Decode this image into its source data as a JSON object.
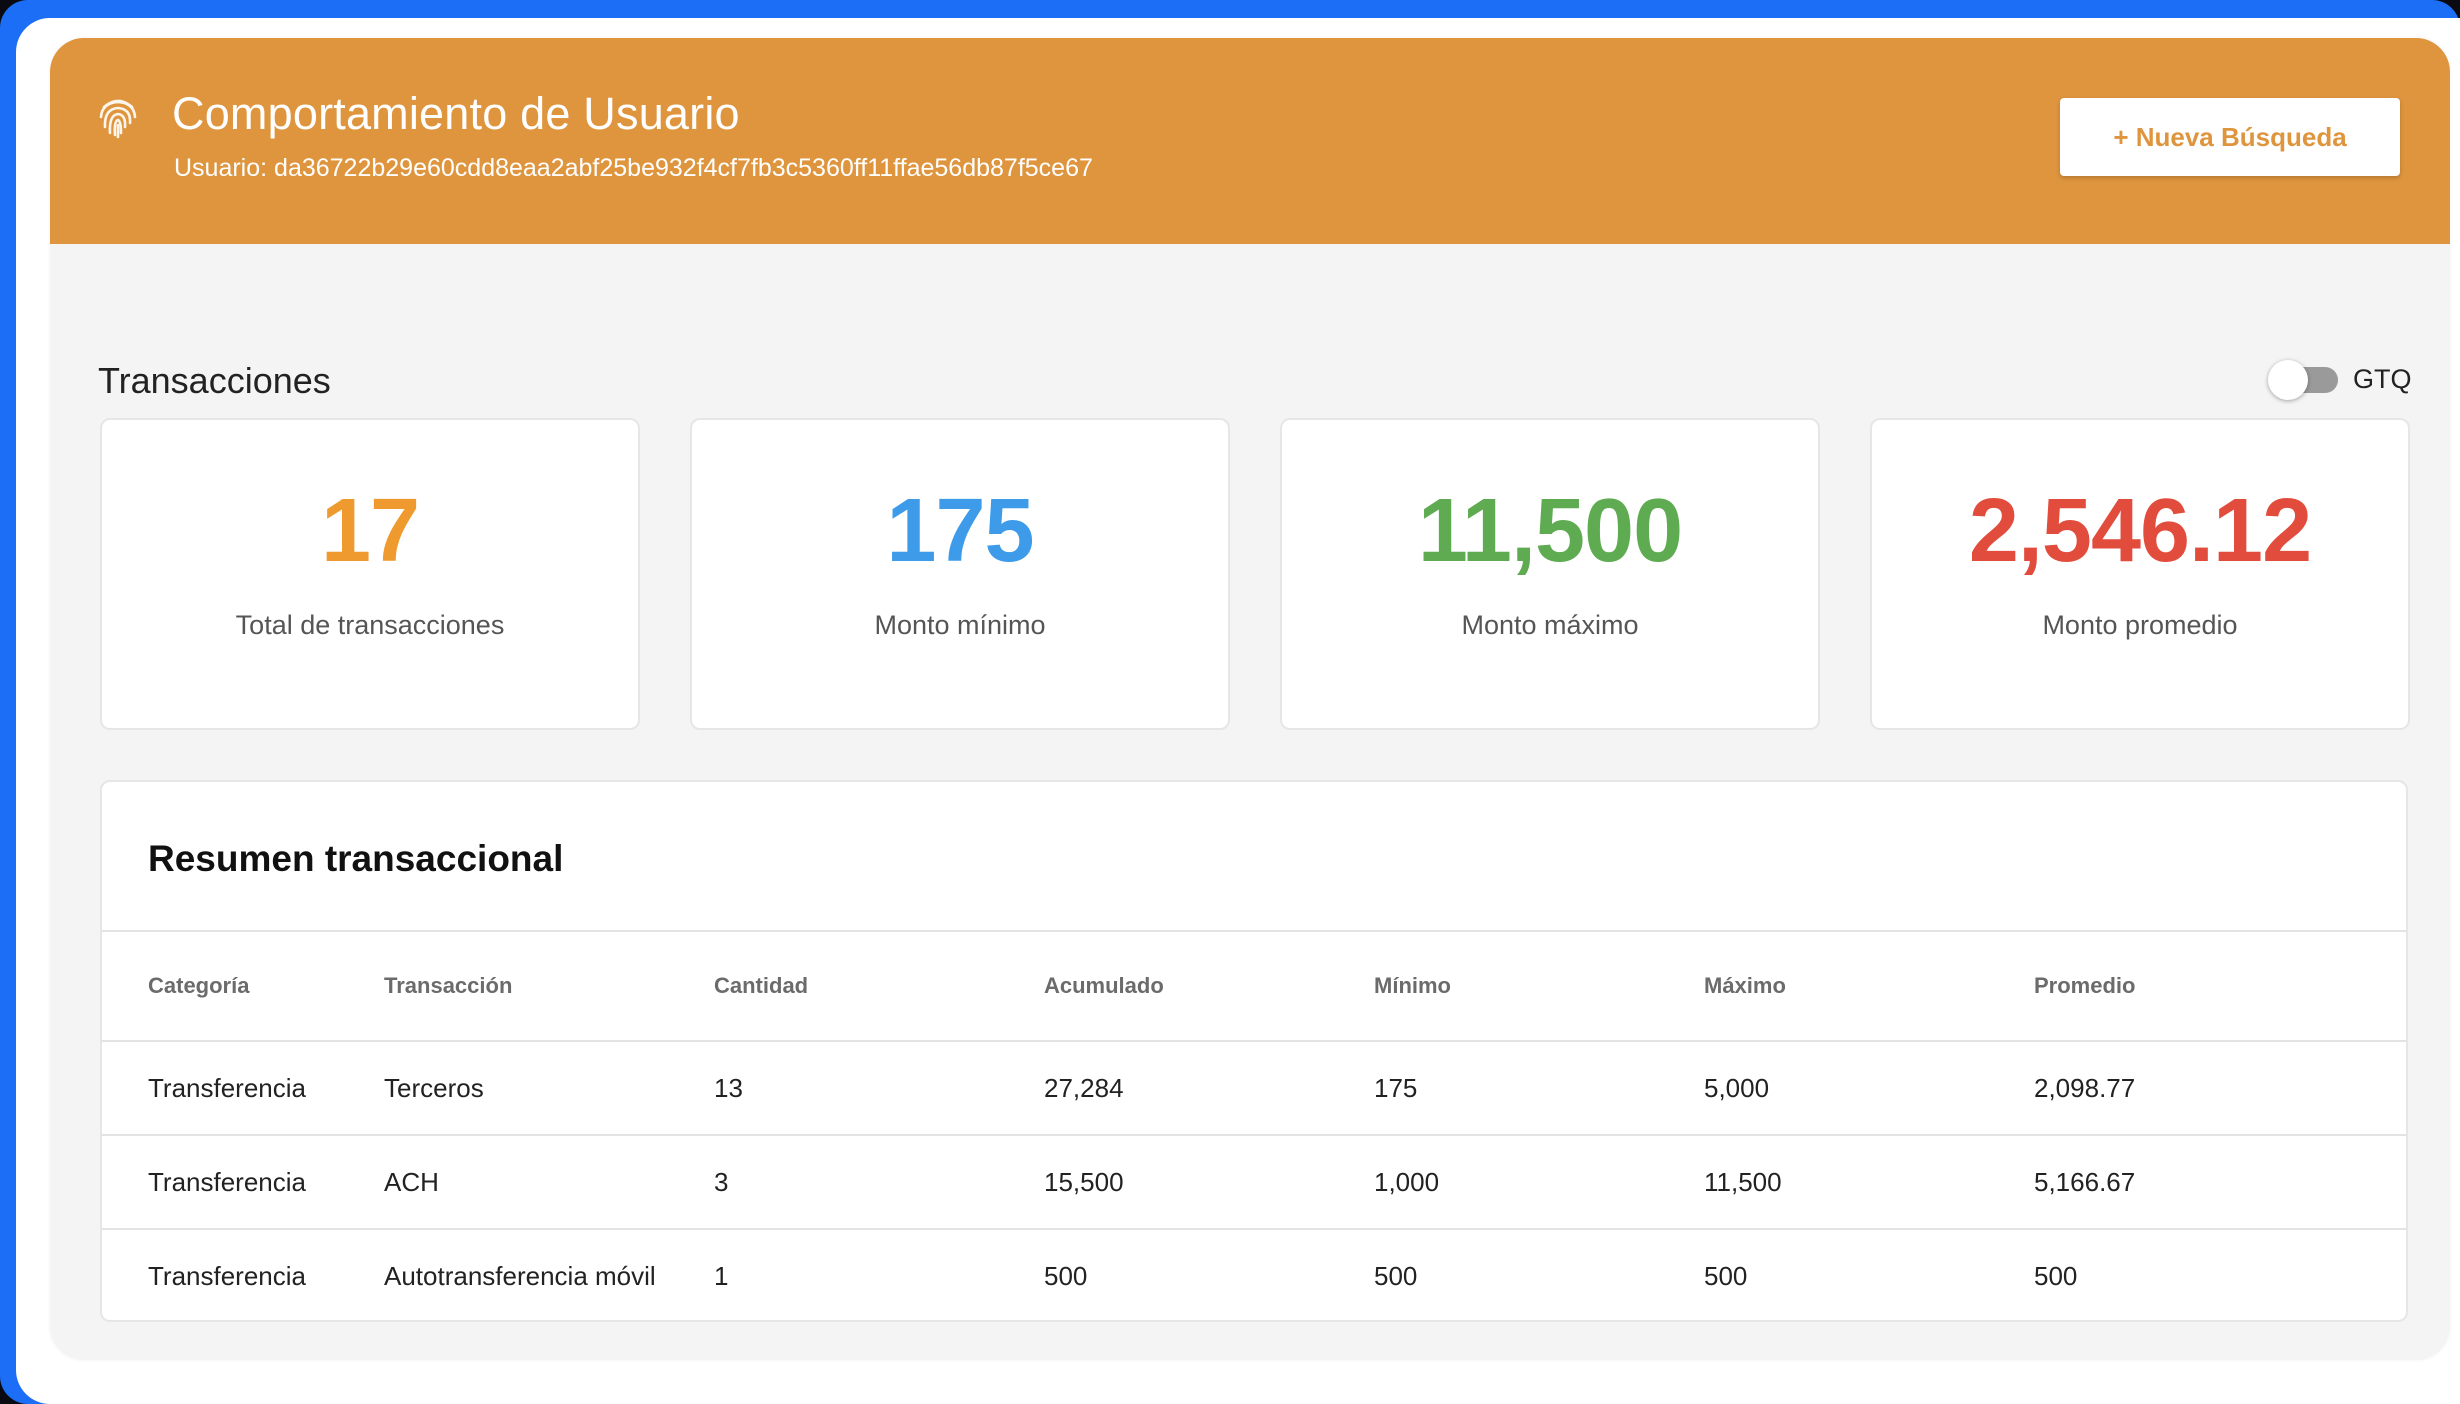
{
  "header": {
    "title": "Comportamiento de Usuario",
    "user_line": "Usuario: da36722b29e60cdd8eaa2abf25be932f4cf7fb3c5360ff11ffae56db87f5ce67",
    "new_search_label": "+ Nueva Búsqueda",
    "icon": "fingerprint-icon",
    "bg_color": "#df953d"
  },
  "transactions": {
    "section_title": "Transacciones",
    "currency_toggle": {
      "label": "GTQ",
      "on": false
    }
  },
  "stats": [
    {
      "value": "17",
      "label": "Total de transacciones",
      "color": "#ef9a2e"
    },
    {
      "value": "175",
      "label": "Monto mínimo",
      "color": "#3d9be9"
    },
    {
      "value": "11,500",
      "label": "Monto máximo",
      "color": "#5eab51"
    },
    {
      "value": "2,546.12",
      "label": "Monto promedio",
      "color": "#e24c3d"
    }
  ],
  "summary": {
    "title": "Resumen transaccional",
    "columns": [
      "Categoría",
      "Transacción",
      "Cantidad",
      "Acumulado",
      "Mínimo",
      "Máximo",
      "Promedio"
    ],
    "rows": [
      [
        "Transferencia",
        "Terceros",
        "13",
        "27,284",
        "175",
        "5,000",
        "2,098.77"
      ],
      [
        "Transferencia",
        "ACH",
        "3",
        "15,500",
        "1,000",
        "11,500",
        "5,166.67"
      ],
      [
        "Transferencia",
        "Autotransferencia móvil",
        "1",
        "500",
        "500",
        "500",
        "500"
      ]
    ]
  }
}
